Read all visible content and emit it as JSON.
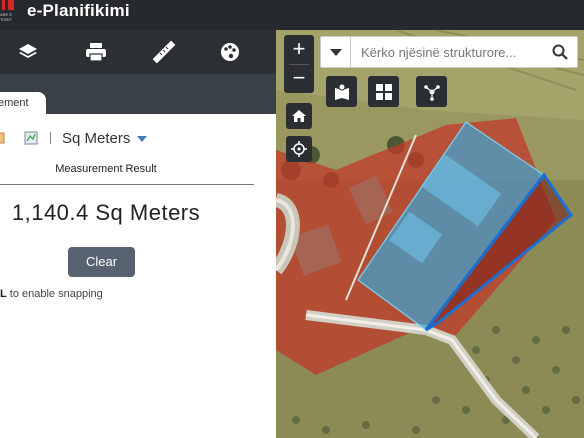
{
  "header": {
    "app_title": "e-Planifikimi",
    "logo_caption": "ARE E\nTORIT"
  },
  "toolbar": {
    "items": [
      {
        "icon": "layers-icon"
      },
      {
        "icon": "print-icon"
      },
      {
        "icon": "measure-ruler-icon"
      },
      {
        "icon": "palette-icon"
      }
    ]
  },
  "panel": {
    "tab_label": "ement",
    "unit": {
      "selected": "Sq Meters"
    },
    "result_title": "Measurement Result",
    "result_value": "1,140.4 Sq Meters",
    "clear_label": "Clear",
    "snap_hint_key": "L",
    "snap_hint_text": " to enable snapping"
  },
  "map": {
    "zoom_in": "+",
    "zoom_out": "−",
    "search_placeholder": "Kërko njësinë strukturore...",
    "colors": {
      "parcel_red": "#c0392b",
      "parcel_blue": "#3aa6d8",
      "outline_blue": "#1a6fd0"
    },
    "tools": [
      {
        "icon": "map-pin-book-icon"
      },
      {
        "icon": "grid-icon"
      },
      {
        "icon": "network-nodes-icon"
      }
    ]
  }
}
